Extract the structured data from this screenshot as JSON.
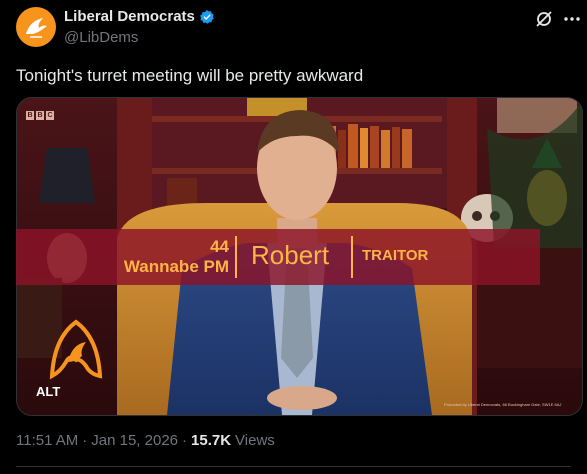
{
  "author": {
    "display_name": "Liberal Democrats",
    "handle": "@LibDems",
    "verified": true,
    "avatar_color": "#f7941d"
  },
  "header_icons": [
    "grok-icon",
    "more-icon"
  ],
  "tweet": {
    "text": "Tonight's turret meeting will be pretty awkward"
  },
  "media": {
    "alt_badge": "ALT",
    "channel_logo": [
      "B",
      "B",
      "C"
    ],
    "lower_third": {
      "age": "44",
      "title": "Wannabe PM",
      "name": "Robert",
      "role": "TRAITOR",
      "bar_color": "#8c1428",
      "text_color": "#ffb347"
    },
    "credit": "Promoted by Liberal Democrats, 66 Buckingham Gate, SW1E 6AJ"
  },
  "meta": {
    "time": "11:51 AM",
    "separator": "·",
    "date": "Jan 15, 2026",
    "views_count": "15.7K",
    "views_label": "Views"
  }
}
